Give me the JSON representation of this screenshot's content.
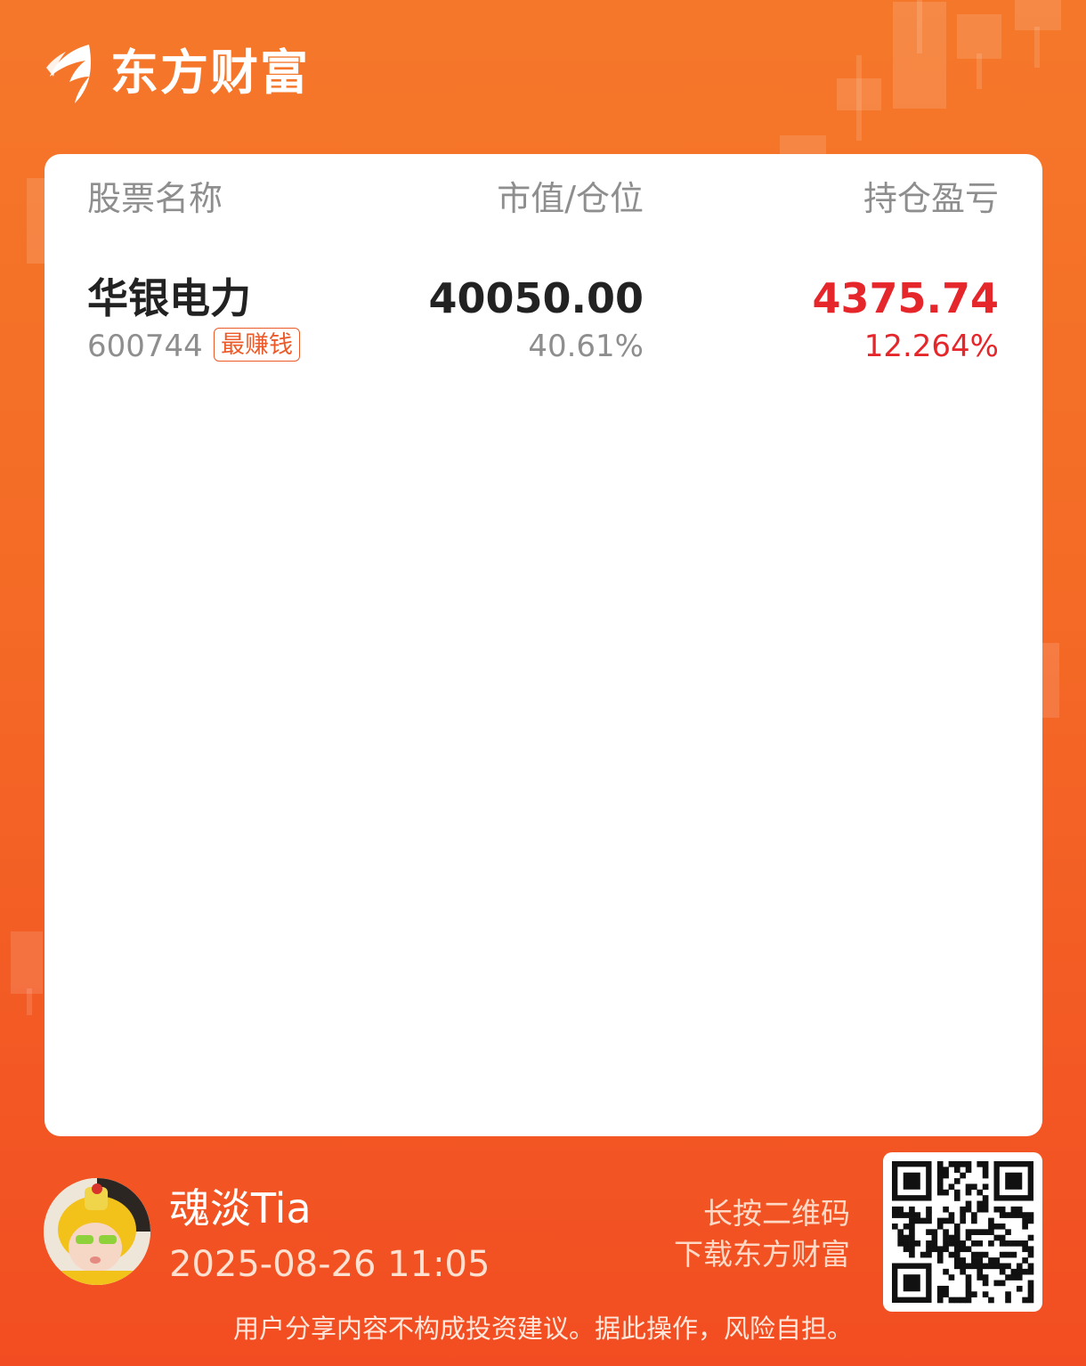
{
  "header": {
    "brand": "东方财富",
    "logo_icon": "eastmoney-logo-icon"
  },
  "table": {
    "columns": [
      "股票名称",
      "市值/仓位",
      "持仓盈亏"
    ],
    "rows": [
      {
        "name": "华银电力",
        "code": "600744",
        "badge": "最赚钱",
        "market_value": "40050.00",
        "position": "40.61%",
        "pnl": "4375.74",
        "pnl_pct": "12.264%"
      }
    ]
  },
  "footer": {
    "username": "魂淡Tia",
    "datetime": "2025-08-26 11:05",
    "qr_hint_line1": "长按二维码",
    "qr_hint_line2": "下载东方财富",
    "disclaimer": "用户分享内容不构成投资建议。据此操作，风险自担。"
  },
  "colors": {
    "accent": "#f46a26",
    "profit": "#e5262a",
    "muted": "#8e8e8e"
  }
}
